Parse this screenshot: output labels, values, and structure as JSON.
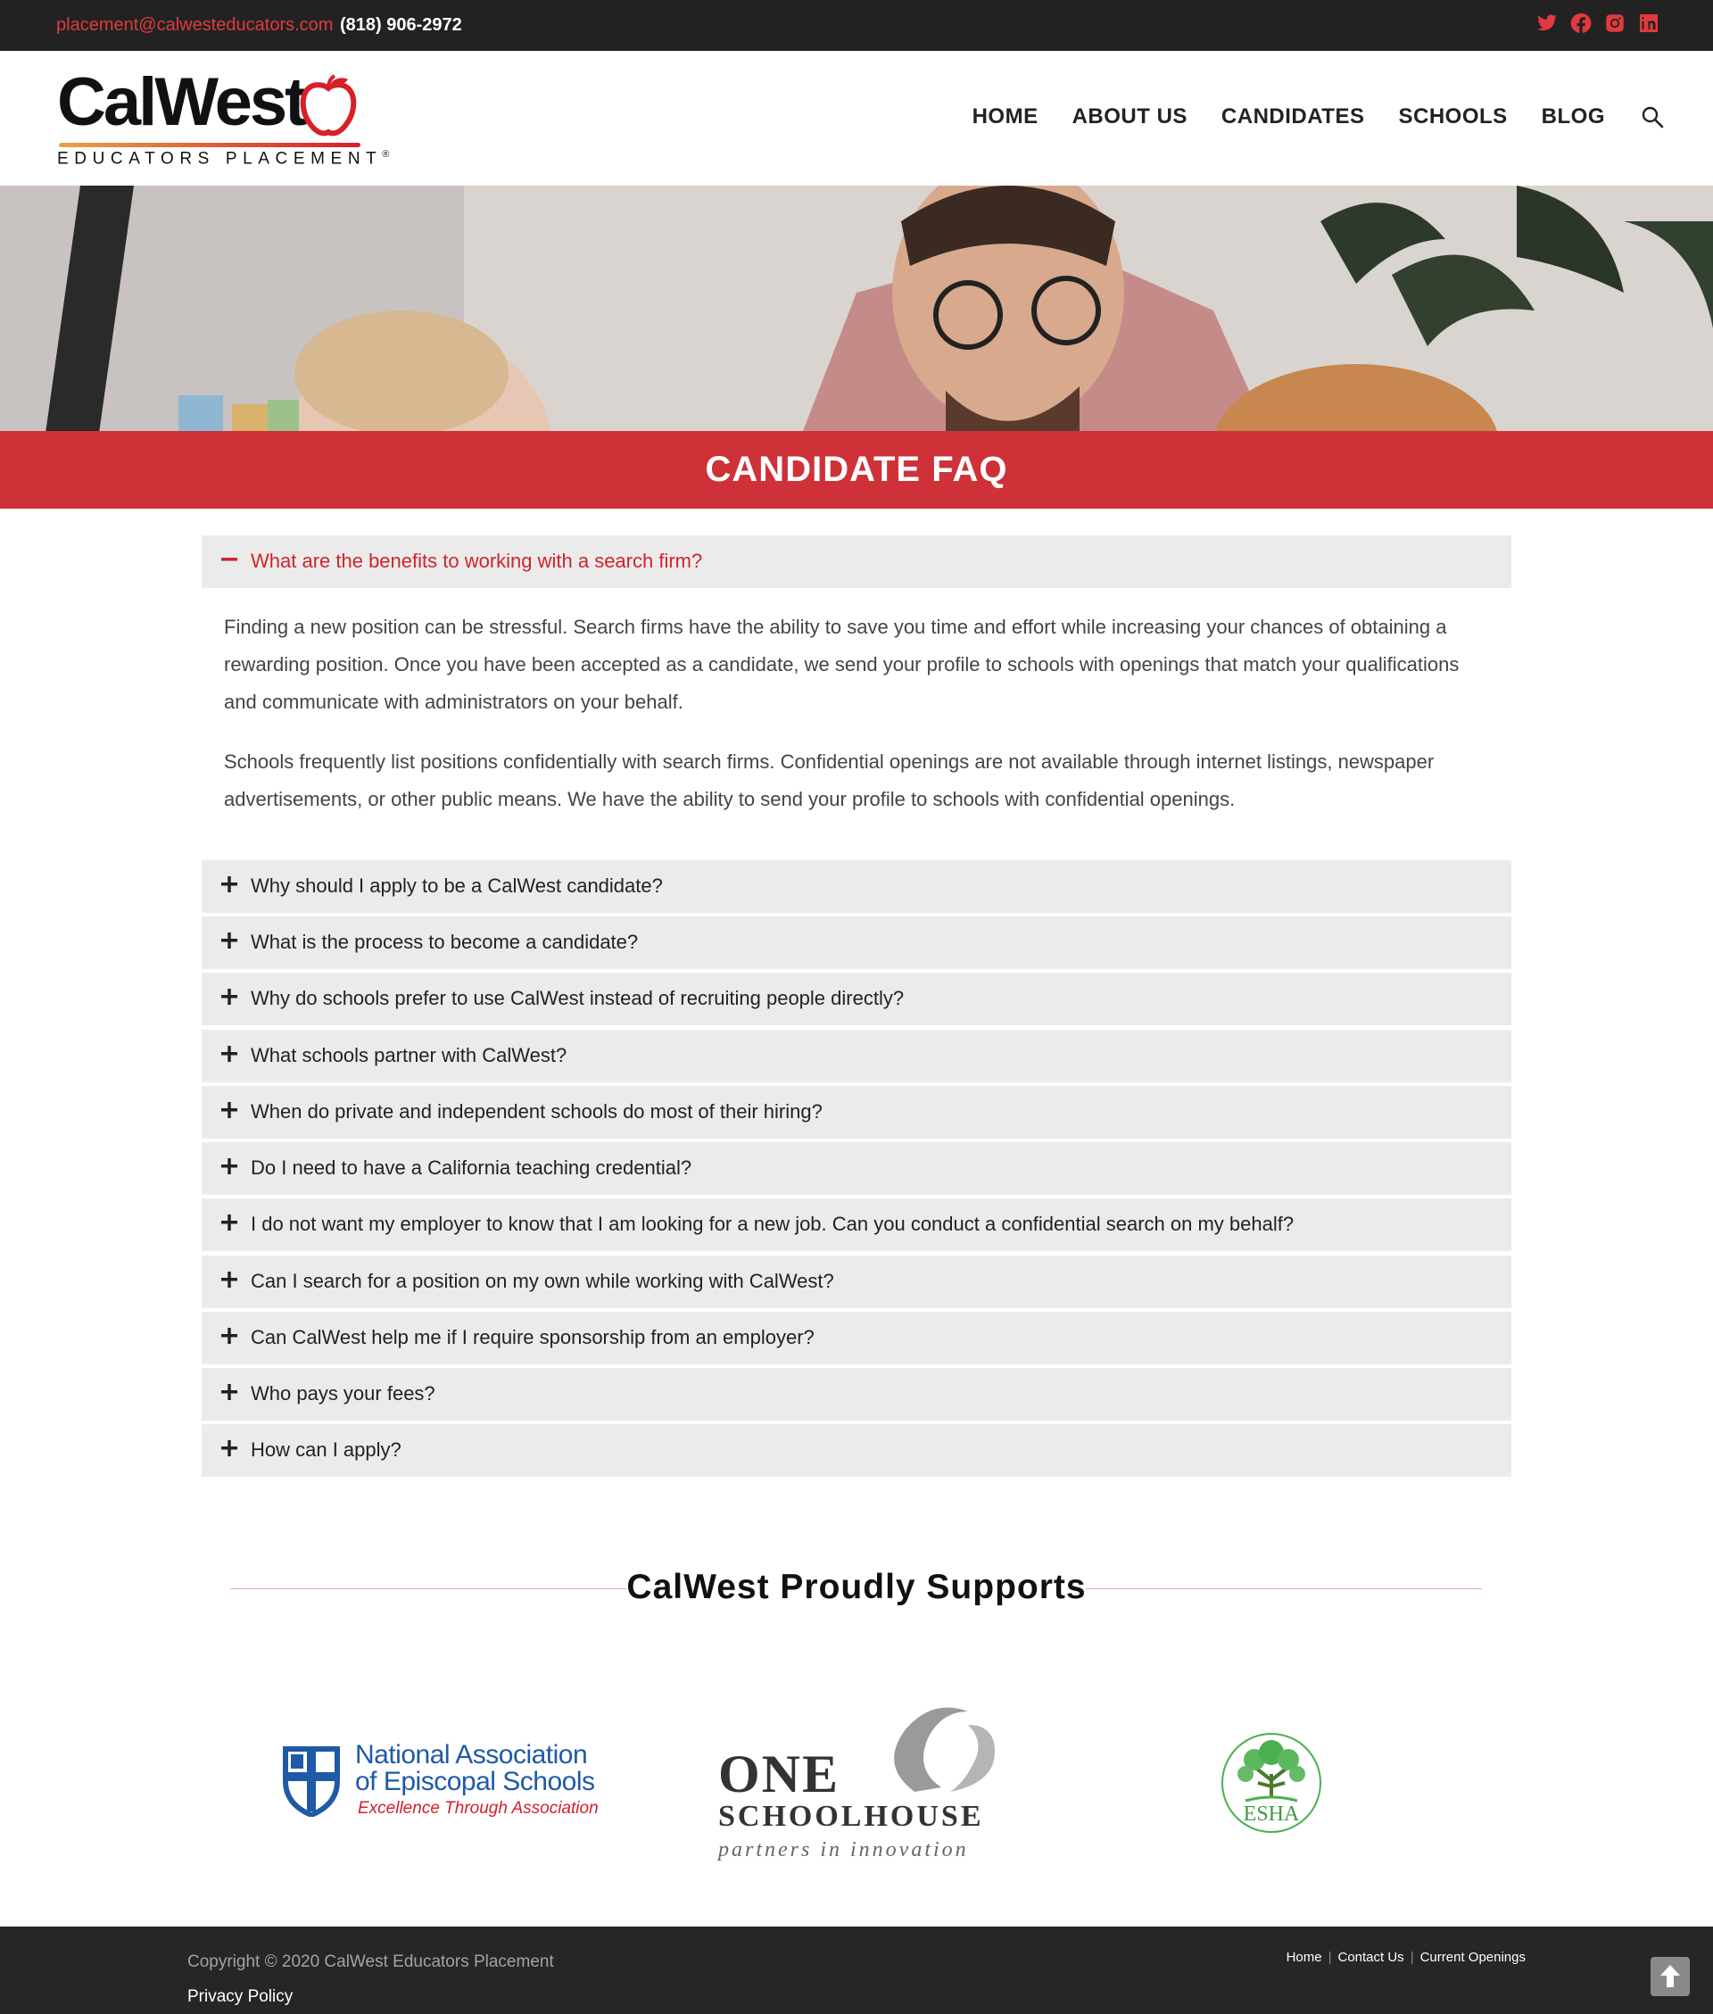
{
  "topbar": {
    "email": "placement@calwesteducators.com",
    "phone": "(818) 906-2972",
    "social_icons": [
      "twitter-icon",
      "facebook-icon",
      "instagram-icon",
      "linkedin-icon"
    ],
    "accent_color": "#e03a3e"
  },
  "header": {
    "logo_brand": "CalWest",
    "logo_tagline": "EDUCATORS PLACEMENT",
    "logo_registered": "®",
    "nav": [
      "HOME",
      "ABOUT US",
      "CANDIDATES",
      "SCHOOLS",
      "BLOG"
    ]
  },
  "page_title": "CANDIDATE FAQ",
  "faq": {
    "open_question": "What are the benefits to working with a search firm?",
    "open_answer": [
      "Finding a new position can be stressful. Search firms have the ability to save you time and effort while increasing your chances of obtaining a rewarding position. Once you have been accepted as a candidate, we send your profile to schools with openings that match your qualifications and communicate with administrators on your behalf.",
      "Schools frequently list positions confidentially with search firms. Confidential openings are not available through internet listings, newspaper advertisements, or other public means. We have the ability to send your profile to schools with confidential openings."
    ],
    "questions": [
      "Why should I apply to be a CalWest candidate?",
      "What is the process to become a candidate?",
      "Why do schools prefer to use CalWest instead of recruiting people directly?",
      "What schools partner with CalWest?",
      "When do private and independent schools do most of their hiring?",
      "Do I need to have a California teaching credential?",
      "I do not want my employer to know that I am looking for a new job. Can you conduct a confidential search on my behalf?",
      "Can I search for a position on my own while working with CalWest?",
      "Can CalWest help me if I require sponsorship from an employer?",
      "Who pays your fees?",
      "How can I apply?"
    ]
  },
  "supports": {
    "title": "CalWest Proudly Supports",
    "partners": [
      {
        "line1": "National Association",
        "line2": "of Episcopal Schools",
        "tagline": "Excellence Through Association"
      },
      {
        "line1": "ONE",
        "line2": "SCHOOLHOUSE",
        "tagline": "partners in innovation"
      },
      {
        "line1": "ESHA"
      }
    ]
  },
  "footer": {
    "copyright": "Copyright © 2020 CalWest Educators Placement",
    "privacy": "Privacy Policy",
    "links": [
      "Home",
      "Contact Us",
      "Current Openings"
    ]
  }
}
